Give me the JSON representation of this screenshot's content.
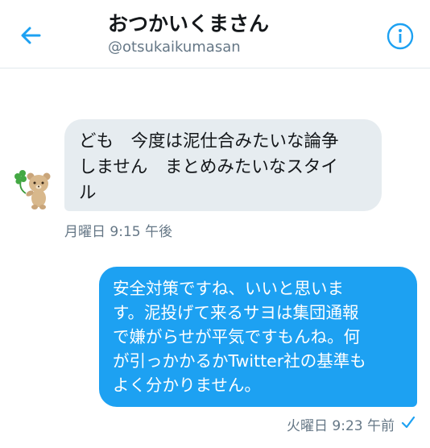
{
  "header": {
    "title": "おつかいくまさん",
    "handle": "@otsukaikumasan",
    "back_icon": "back-arrow-icon",
    "info_icon": "info-icon"
  },
  "colors": {
    "accent": "#1da1f2",
    "received_bubble": "#e6ecf0",
    "text_dark": "#14171a",
    "text_muted": "#657786"
  },
  "messages": [
    {
      "direction": "received",
      "avatar": "bear-with-clover-avatar",
      "lines": [
        "ども　今度は泥仕合みたいな論争",
        "しません　まとめみたいなスタイ",
        "ル"
      ],
      "timestamp": "月曜日 9:15 午後"
    },
    {
      "direction": "sent",
      "lines": [
        "安全対策ですね、いいと思いま",
        "す。泥投げて来るサヨは集団通報",
        "で嫌がらせが平気ですもんね。何",
        "が引っかかるかTwitter社の基準も",
        "よく分かりません。"
      ],
      "timestamp": "火曜日 9:23 午前",
      "status_icon": "checkmark-icon"
    }
  ]
}
